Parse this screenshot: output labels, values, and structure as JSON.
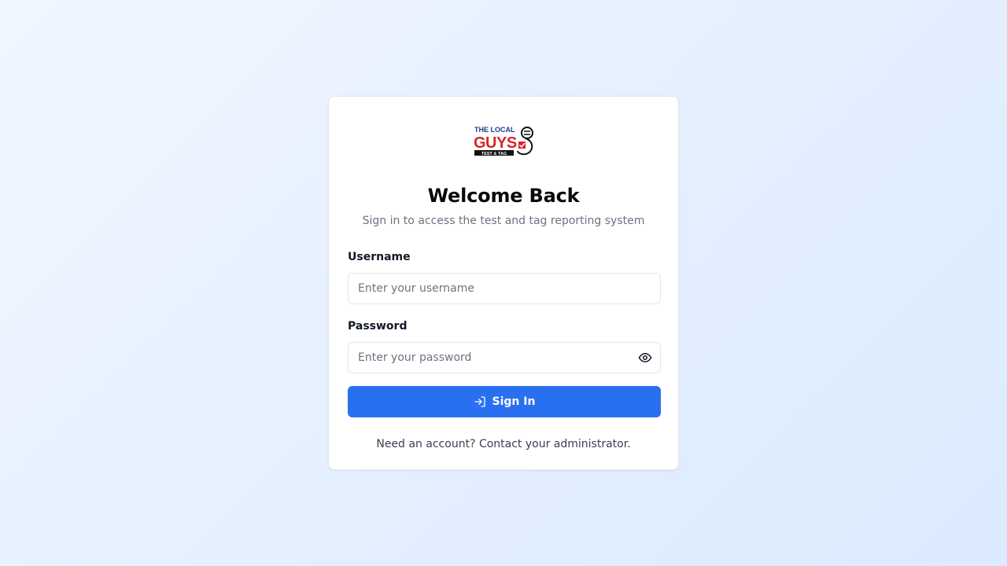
{
  "logo": {
    "text_line1": "THE LOCAL",
    "text_line2": "GUYS",
    "text_line3": "TEST & TAG",
    "brand_red": "#d7262b",
    "brand_navy": "#1e3a8a"
  },
  "login": {
    "title": "Welcome Back",
    "subtitle": "Sign in to access the test and tag reporting system",
    "username_label": "Username",
    "username_placeholder": "Enter your username",
    "username_value": "",
    "password_label": "Password",
    "password_placeholder": "Enter your password",
    "password_value": "",
    "password_toggle_icon": "eye-icon",
    "submit_icon": "log-in-icon",
    "submit_label": "Sign In",
    "footer_text": "Need an account? Contact your administrator."
  },
  "colors": {
    "accent": "#2970f0",
    "background_start": "#eff6ff",
    "background_end": "#dbeafe"
  }
}
